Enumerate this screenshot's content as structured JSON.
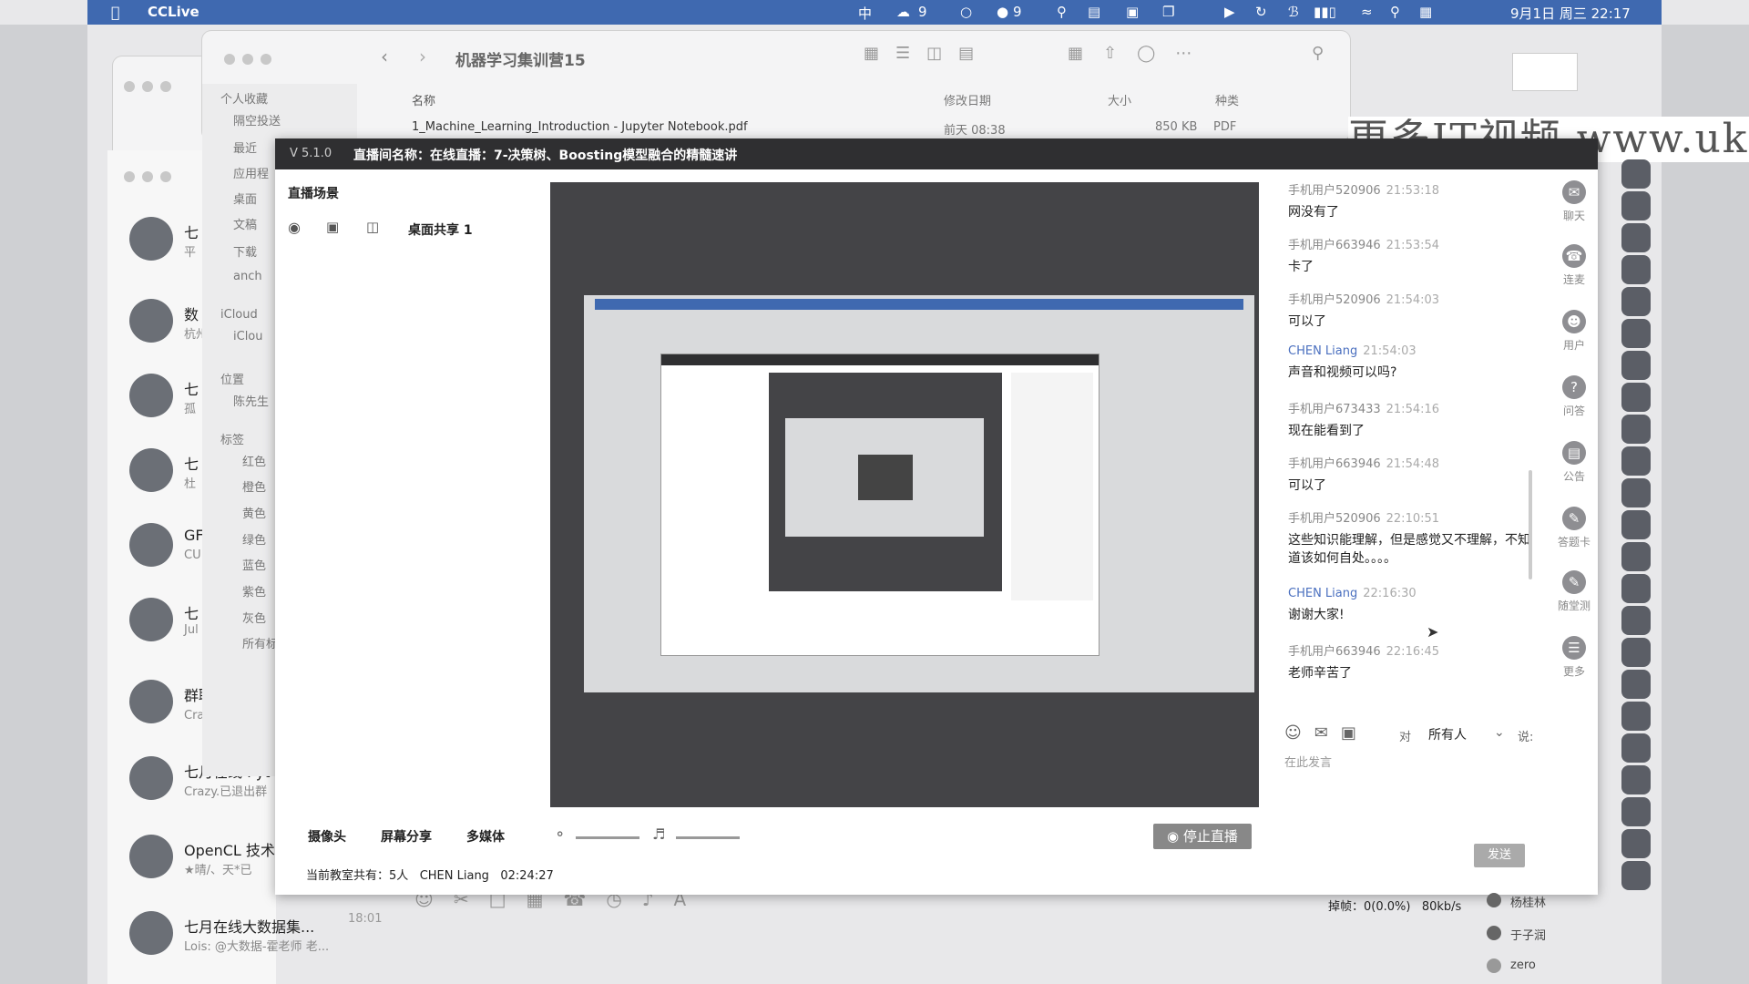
{
  "menubar": {
    "app_name": "CCLive",
    "wechat_count": "9",
    "qq_count": "9",
    "datetime": "9月1日 周三 22:17"
  },
  "finder": {
    "title": "机器学习集训营15",
    "sidebar": {
      "favorites_header": "个人收藏",
      "favorites": [
        "隔空投送",
        "最近",
        "应用程",
        "桌面",
        "文稿",
        "下载",
        "anch"
      ],
      "icloud_header": "iCloud",
      "icloud_items": [
        "iClou"
      ],
      "locations_header": "位置",
      "locations": [
        "陈先生"
      ],
      "tags_header": "标签",
      "tags": [
        "红色",
        "橙色",
        "黄色",
        "绿色",
        "蓝色",
        "紫色",
        "灰色",
        "所有标"
      ]
    },
    "columns": {
      "name": "名称",
      "date": "修改日期",
      "size": "大小",
      "kind": "种类"
    },
    "file": {
      "name": "1_Machine_Learning_Introduction - Jupyter Notebook.pdf",
      "date": "前天 08:38",
      "size": "850 KB",
      "kind": "PDF"
    }
  },
  "chat_list": [
    {
      "title": "七",
      "sub": "平"
    },
    {
      "title": "数",
      "sub": "杭州"
    },
    {
      "title": "七",
      "sub": "孤"
    },
    {
      "title": "七",
      "sub": "杜"
    },
    {
      "title": "GF",
      "sub": "CU"
    },
    {
      "title": "七",
      "sub": "Jul"
    },
    {
      "title": "群聊系统消息",
      "sub": "Crazy. 退出群 七"
    },
    {
      "title": "七月在线 Pyt",
      "sub": "Crazy.已退出群"
    },
    {
      "title": "OpenCL 技术",
      "sub": "★晴/、天*已"
    },
    {
      "title": "七月在线大数据集...",
      "sub": "Lois: @大数据-霍老师 老...",
      "time": "18:01"
    }
  ],
  "live": {
    "version": "V 5.1.0",
    "room_title": "直播间名称：在线直播：7-决策树、Boosting模型融合的精髓速讲",
    "scene_header": "直播场景",
    "scene_item": "桌面共享 1",
    "camera_label": "摄像头",
    "screen_share_label": "屏幕分享",
    "multimedia_label": "多媒体",
    "stop_label": "停止直播",
    "status_prefix": "当前教室共有：",
    "people_count": "5人",
    "host_name": "CHEN Liang",
    "elapsed": "02:24:27",
    "dropped_frames": "掉帧：0(0.0%)",
    "bitrate": "80kb/s",
    "send_label": "发送",
    "to_label": "对",
    "to_target": "所有人",
    "say_label": "说:",
    "input_placeholder": "在此发言"
  },
  "messages": [
    {
      "user": "手机用户520906",
      "time": "21:53:18",
      "text": "网没有了",
      "teacher": false
    },
    {
      "user": "手机用户663946",
      "time": "21:53:54",
      "text": "卡了",
      "teacher": false
    },
    {
      "user": "手机用户520906",
      "time": "21:54:03",
      "text": "可以了",
      "teacher": false
    },
    {
      "user": "CHEN Liang",
      "time": "21:54:03",
      "text": "声音和视频可以吗?",
      "teacher": true
    },
    {
      "user": "手机用户673433",
      "time": "21:54:16",
      "text": "现在能看到了",
      "teacher": false
    },
    {
      "user": "手机用户663946",
      "time": "21:54:48",
      "text": "可以了",
      "teacher": false
    },
    {
      "user": "手机用户520906",
      "time": "22:10:51",
      "text": "这些知识能理解，但是感觉又不理解，不知道该如何自处。。。。",
      "teacher": false
    },
    {
      "user": "CHEN Liang",
      "time": "22:16:30",
      "text": "谢谢大家!",
      "teacher": true
    },
    {
      "user": "手机用户663946",
      "time": "22:16:45",
      "text": "老师辛苦了",
      "teacher": false
    }
  ],
  "rail": [
    "聊天",
    "连麦",
    "用户",
    "问答",
    "公告",
    "答题卡",
    "随堂测",
    "更多"
  ],
  "members": [
    "杨桂林",
    "于子润",
    "zero"
  ],
  "watermark": "更多IT视频 www.ukoou.c",
  "colors": {
    "menubar": "#3f69b0",
    "title_bar": "#2f2f31",
    "teacher": "#4a6fbf",
    "video_bg": "#444447"
  }
}
